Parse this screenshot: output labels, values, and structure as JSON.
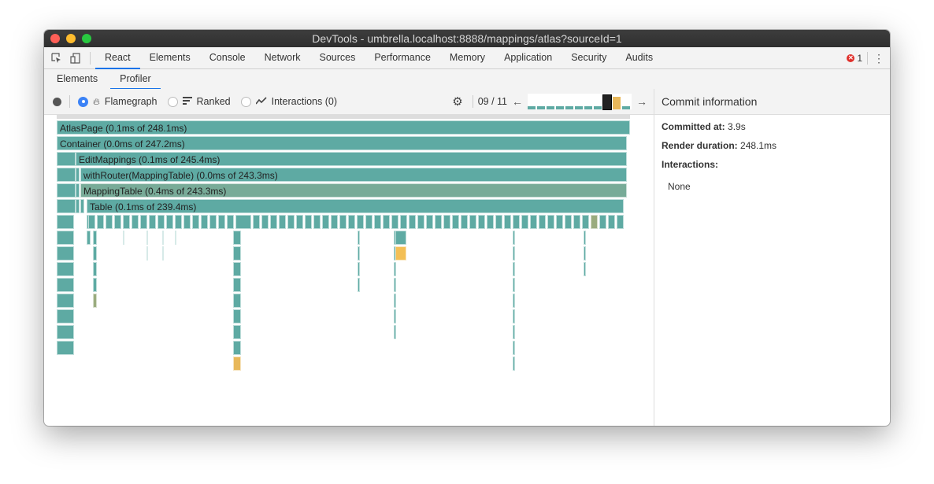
{
  "window": {
    "title": "DevTools - umbrella.localhost:8888/mappings/atlas?sourceId=1"
  },
  "tabs": [
    {
      "label": "React",
      "active": true
    },
    {
      "label": "Elements"
    },
    {
      "label": "Console"
    },
    {
      "label": "Network"
    },
    {
      "label": "Sources"
    },
    {
      "label": "Performance"
    },
    {
      "label": "Memory"
    },
    {
      "label": "Application"
    },
    {
      "label": "Security"
    },
    {
      "label": "Audits"
    }
  ],
  "error_count": "1",
  "subtabs": [
    {
      "label": "Elements"
    },
    {
      "label": "Profiler",
      "active": true
    }
  ],
  "toolbar": {
    "modes": [
      {
        "label": "Flamegraph",
        "icon": "flame-icon",
        "selected": true
      },
      {
        "label": "Ranked",
        "icon": "ranked-icon",
        "selected": false
      },
      {
        "label": "Interactions (0)",
        "icon": "interactions-icon",
        "selected": false
      }
    ],
    "commit_index": "09 / 11",
    "commits": [
      {
        "h": 0.2,
        "color": "#5eaaa3"
      },
      {
        "h": 0.2,
        "color": "#5eaaa3"
      },
      {
        "h": 0.2,
        "color": "#5eaaa3"
      },
      {
        "h": 0.2,
        "color": "#5eaaa3"
      },
      {
        "h": 0.2,
        "color": "#5eaaa3"
      },
      {
        "h": 0.2,
        "color": "#5eaaa3"
      },
      {
        "h": 0.2,
        "color": "#5eaaa3"
      },
      {
        "h": 0.2,
        "color": "#5eaaa3"
      },
      {
        "h": 1.0,
        "color": "#222222",
        "selected": true
      },
      {
        "h": 0.9,
        "color": "#e8b85a"
      },
      {
        "h": 0.2,
        "color": "#5eaaa3"
      }
    ]
  },
  "flamegraph": {
    "rows": [
      {
        "label": "AtlasPage (0.1ms of 248.1ms)",
        "color": "#5eaaa3"
      },
      {
        "label": "Container (0.0ms of 247.2ms)",
        "color": "#5eaaa3"
      },
      {
        "label": "EditMappings (0.1ms of 245.4ms)",
        "color": "#5eaaa3"
      },
      {
        "label": "withRouter(MappingTable) (0.0ms of 243.3ms)",
        "color": "#5eaaa3"
      },
      {
        "label": "MappingTable (0.4ms of 243.3ms)",
        "color": "#78ab98"
      },
      {
        "label": "Table (0.1ms of 239.4ms)",
        "color": "#5eaaa3"
      }
    ]
  },
  "commit_info": {
    "title": "Commit information",
    "committed_at_label": "Committed at",
    "committed_at": "3.9s",
    "render_duration_label": "Render duration",
    "render_duration": "248.1ms",
    "interactions_label": "Interactions",
    "interactions_value": "None"
  }
}
